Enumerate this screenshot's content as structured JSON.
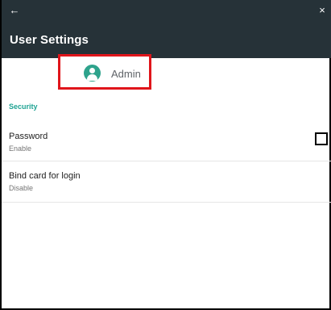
{
  "appbar": {
    "back_icon": "←",
    "close_icon": "×",
    "title": "User Settings"
  },
  "profile": {
    "avatar_icon": "person-icon",
    "name": "Admin"
  },
  "security": {
    "header": "Security",
    "items": [
      {
        "label": "Password",
        "value": "Enable"
      },
      {
        "label": "Bind card for login",
        "value": "Disable"
      }
    ]
  },
  "colors": {
    "appbar": "#263238",
    "accent": "#1fa393",
    "avatar": "#2ea38c",
    "highlight": "#e0151b"
  }
}
